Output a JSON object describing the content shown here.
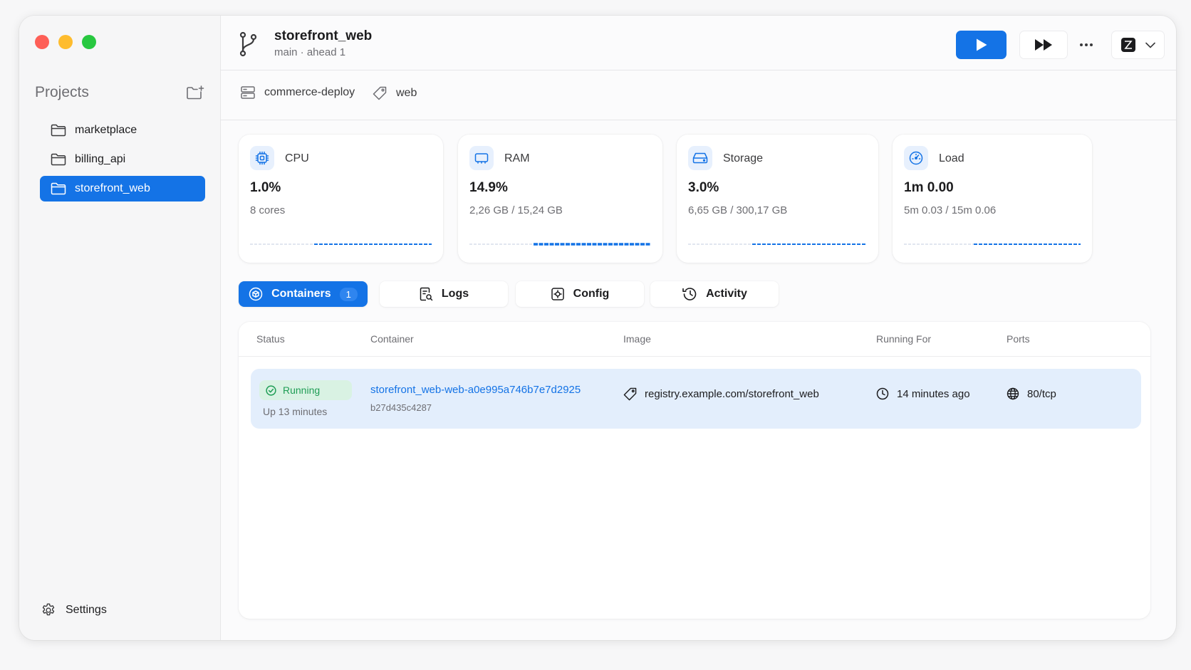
{
  "sidebar": {
    "projects_title": "Projects",
    "projects": [
      {
        "label": "marketplace",
        "active": false
      },
      {
        "label": "billing_api",
        "active": false
      },
      {
        "label": "storefront_web",
        "active": true
      }
    ],
    "settings_label": "Settings"
  },
  "header": {
    "repo_name": "storefront_web",
    "branch_info": "main · ahead 1"
  },
  "subbar": {
    "stack": "commerce-deploy",
    "service": "web"
  },
  "metrics": {
    "cpu": {
      "label": "CPU",
      "value": "1.0%",
      "detail": "8 cores"
    },
    "ram": {
      "label": "RAM",
      "value": "14.9%",
      "detail": "2,26 GB / 15,24 GB"
    },
    "storage": {
      "label": "Storage",
      "value": "3.0%",
      "detail": "6,65 GB / 300,17 GB"
    },
    "load": {
      "label": "Load",
      "value": "1m 0.00",
      "detail": "5m 0.03 / 15m 0.06"
    }
  },
  "tabs": {
    "containers": {
      "label": "Containers",
      "count": "1"
    },
    "logs": {
      "label": "Logs"
    },
    "config": {
      "label": "Config"
    },
    "activity": {
      "label": "Activity"
    }
  },
  "table": {
    "headers": {
      "status": "Status",
      "container": "Container",
      "image": "Image",
      "running_for": "Running For",
      "ports": "Ports"
    },
    "rows": [
      {
        "status": "Running",
        "uptime": "Up 13 minutes",
        "container_name": "storefront_web-web-a0e995a746b7e7d2925",
        "container_id": "b27d435c4287",
        "image": "registry.example.com/storefront_web",
        "running_for": "14 minutes ago",
        "ports": "80/tcp"
      }
    ]
  },
  "colors": {
    "accent": "#1473e6",
    "running_green": "#1f9d55",
    "running_bg": "#d9f2e3",
    "row_highlight": "#e3eefc"
  }
}
